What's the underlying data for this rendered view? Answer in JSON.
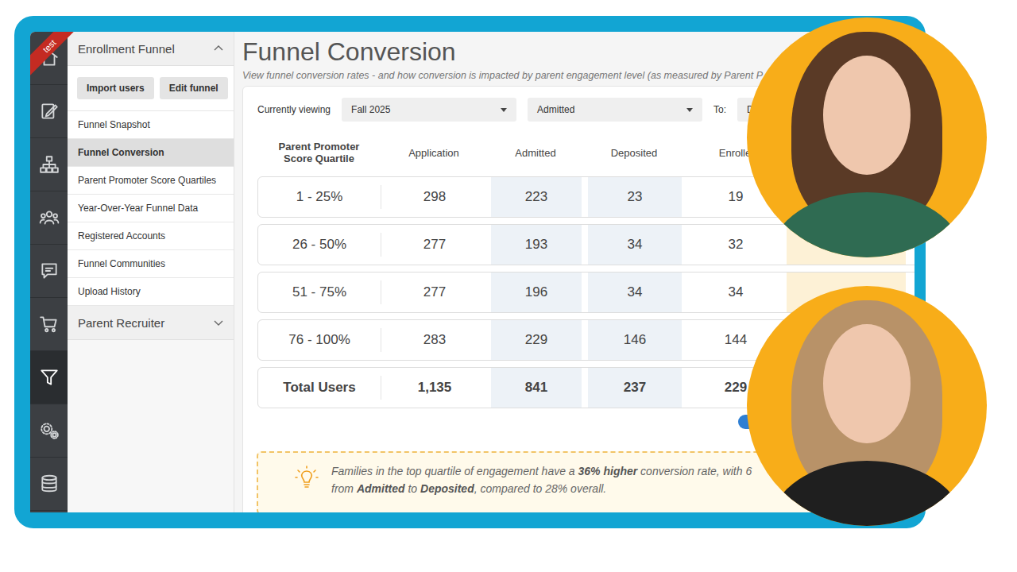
{
  "ribbon": "test",
  "rail": [
    {
      "selected": false
    },
    {
      "selected": false
    },
    {
      "selected": false
    },
    {
      "selected": false
    },
    {
      "selected": false
    },
    {
      "selected": false
    },
    {
      "selected": true
    },
    {
      "selected": false
    },
    {
      "selected": false
    }
  ],
  "sidebar": {
    "sections": [
      {
        "title": "Enrollment Funnel",
        "expanded": true,
        "buttons": [
          "Import users",
          "Edit funnel"
        ],
        "items": [
          {
            "label": "Funnel Snapshot",
            "selected": false
          },
          {
            "label": "Funnel Conversion",
            "selected": true
          },
          {
            "label": "Parent Promoter Score Quartiles",
            "selected": false
          },
          {
            "label": "Year-Over-Year Funnel Data",
            "selected": false
          },
          {
            "label": "Registered Accounts",
            "selected": false
          },
          {
            "label": "Funnel Communities",
            "selected": false
          },
          {
            "label": "Upload History",
            "selected": false
          }
        ]
      },
      {
        "title": "Parent Recruiter",
        "expanded": false,
        "buttons": [],
        "items": []
      }
    ]
  },
  "page": {
    "title": "Funnel Conversion",
    "subtitle": "View funnel conversion rates - and how conversion is impacted by parent engagement level (as measured by Parent P"
  },
  "filters": {
    "label": "Currently viewing",
    "selects": [
      "Fall 2025",
      "Admitted"
    ],
    "to_label": "To:",
    "to_select": "D"
  },
  "table": {
    "columns": [
      "Parent Promoter Score Quartile",
      "Application",
      "Admitted",
      "Deposited",
      "Enrolle"
    ],
    "rows": [
      {
        "kind": "quartile",
        "cells": [
          "1 - 25%",
          "298",
          "223",
          "23",
          "19"
        ]
      },
      {
        "kind": "quartile",
        "cells": [
          "26 - 50%",
          "277",
          "193",
          "34",
          "32"
        ]
      },
      {
        "kind": "quartile",
        "cells": [
          "51 - 75%",
          "277",
          "196",
          "34",
          "34"
        ]
      },
      {
        "kind": "quartile",
        "cells": [
          "76 - 100%",
          "283",
          "229",
          "146",
          "144"
        ]
      },
      {
        "kind": "total",
        "cells": [
          "Total Users",
          "1,135",
          "841",
          "237",
          "229"
        ]
      }
    ]
  },
  "toggle": {
    "on": true
  },
  "insight": {
    "lines": [
      [
        {
          "text": "Families in the top quartile of engagement have a ",
          "bold": false
        },
        {
          "text": "36% higher",
          "bold": true
        },
        {
          "text": " conversion rate, with 6",
          "bold": false
        }
      ],
      [
        {
          "text": "from ",
          "bold": false
        },
        {
          "text": "Admitted",
          "bold": true
        },
        {
          "text": " to ",
          "bold": false
        },
        {
          "text": "Deposited",
          "bold": true
        },
        {
          "text": ", compared to 28% overall.",
          "bold": false
        }
      ]
    ]
  }
}
